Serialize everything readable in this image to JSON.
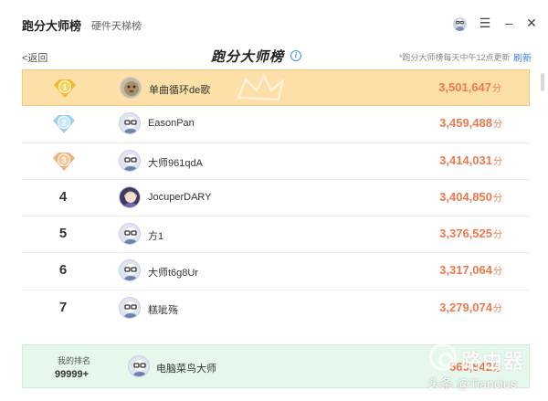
{
  "app": {
    "title": "跑分大师榜",
    "tab": "硬件天梯榜"
  },
  "subheader": {
    "back": "<返回",
    "title": "跑分大师榜",
    "info_icon": "info-icon",
    "update_note": "*跑分大师榜每天中午12点更新",
    "refresh": "刷新"
  },
  "colors": {
    "first_row_bg": "#fde0a8",
    "score": "#f07850",
    "my_rank_bg": "#e6f8ec"
  },
  "ranking": [
    {
      "rank": "1",
      "badge": "gold",
      "name": "单曲循环de歌",
      "score": "3,501,647",
      "unit": "分"
    },
    {
      "rank": "2",
      "badge": "silver",
      "name": "EasonPan",
      "score": "3,459,488",
      "unit": "分"
    },
    {
      "rank": "3",
      "badge": "bronze",
      "name": "大师961qdA",
      "score": "3,414,031",
      "unit": "分"
    },
    {
      "rank": "4",
      "badge": "",
      "name": "JocuperDARY",
      "score": "3,404,850",
      "unit": "分"
    },
    {
      "rank": "5",
      "badge": "",
      "name": "方1",
      "score": "3,376,525",
      "unit": "分"
    },
    {
      "rank": "6",
      "badge": "",
      "name": "大师t6g8Ur",
      "score": "3,317,064",
      "unit": "分"
    },
    {
      "rank": "7",
      "badge": "",
      "name": "糕呲殇",
      "score": "3,279,074",
      "unit": "分"
    }
  ],
  "my_rank": {
    "label": "我的排名",
    "value": "99999+",
    "name": "电脑菜鸟大师",
    "score": "560,842",
    "unit": "分"
  },
  "watermark": {
    "site": "路由器",
    "author": "头条 @Tiancius"
  }
}
